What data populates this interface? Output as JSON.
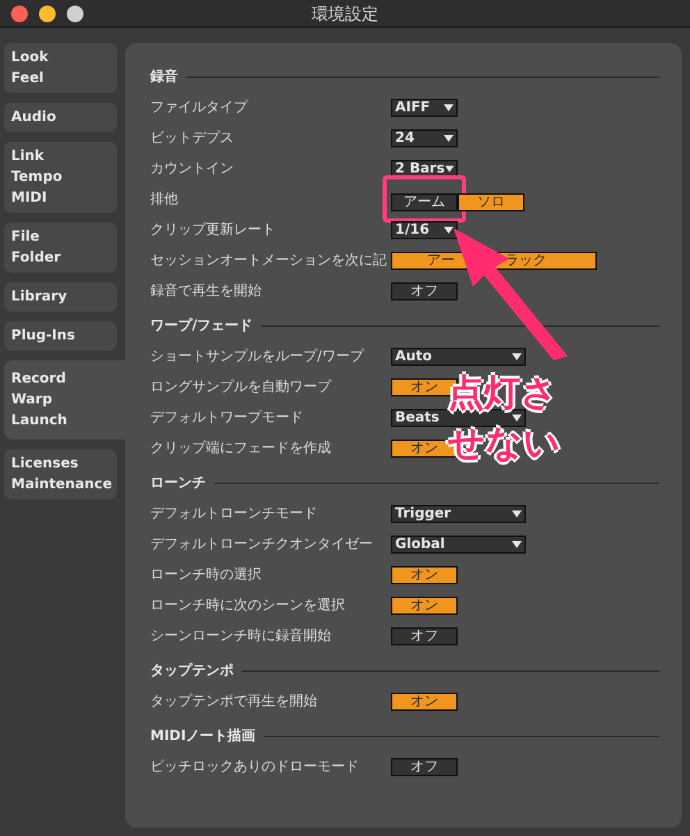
{
  "window": {
    "title": "環境設定"
  },
  "sidebar": [
    {
      "lines": [
        "Look",
        "Feel"
      ],
      "selected": false
    },
    {
      "lines": [
        "Audio"
      ],
      "selected": false
    },
    {
      "lines": [
        "Link",
        "Tempo",
        "MIDI"
      ],
      "selected": false
    },
    {
      "lines": [
        "File",
        "Folder"
      ],
      "selected": false
    },
    {
      "lines": [
        "Library"
      ],
      "selected": false
    },
    {
      "lines": [
        "Plug-Ins"
      ],
      "selected": false
    },
    {
      "lines": [
        "Record",
        "Warp",
        "Launch"
      ],
      "selected": true
    },
    {
      "lines": [
        "Licenses",
        "Maintenance"
      ],
      "selected": false
    }
  ],
  "sections": [
    {
      "title": "録音",
      "rows": [
        {
          "label": "ファイルタイプ",
          "control": {
            "kind": "dropdown",
            "value": "AIFF"
          }
        },
        {
          "label": "ビットデプス",
          "control": {
            "kind": "dropdown",
            "value": "24"
          }
        },
        {
          "label": "カウントイン",
          "control": {
            "kind": "dropdown",
            "value": "2 Bars"
          }
        },
        {
          "label": "排他",
          "control": {
            "kind": "toggle_pair",
            "buttons": [
              {
                "label": "アーム",
                "on": false,
                "highlighted": true
              },
              {
                "label": "ソロ",
                "on": true,
                "highlighted": false
              }
            ]
          }
        },
        {
          "label": "クリップ更新レート",
          "control": {
            "kind": "dropdown",
            "value": "1/16"
          }
        },
        {
          "label": "セッションオートメーションを次に記",
          "control": {
            "kind": "toggle_long",
            "label_parts": [
              "アー",
              "ラック"
            ],
            "on": true
          }
        },
        {
          "label": "録音で再生を開始",
          "control": {
            "kind": "toggle",
            "label": "オフ",
            "on": false
          }
        }
      ]
    },
    {
      "title": "ワープ/フェード",
      "rows": [
        {
          "label": "ショートサンプルをループ/ワープ",
          "control": {
            "kind": "dropdown_long",
            "value": "Auto"
          }
        },
        {
          "label": "ロングサンプルを自動ワープ",
          "control": {
            "kind": "toggle",
            "label": "オン",
            "on": true
          }
        },
        {
          "label": "デフォルトワープモード",
          "control": {
            "kind": "dropdown_long",
            "value": "Beats"
          }
        },
        {
          "label": "クリップ端にフェードを作成",
          "control": {
            "kind": "toggle",
            "label": "オン",
            "on": true
          }
        }
      ]
    },
    {
      "title": "ローンチ",
      "rows": [
        {
          "label": "デフォルトローンチモード",
          "control": {
            "kind": "dropdown_long",
            "value": "Trigger"
          }
        },
        {
          "label": "デフォルトローンチクオンタイゼー",
          "control": {
            "kind": "dropdown_long",
            "value": "Global"
          }
        },
        {
          "label": "ローンチ時の選択",
          "control": {
            "kind": "toggle",
            "label": "オン",
            "on": true
          }
        },
        {
          "label": "ローンチ時に次のシーンを選択",
          "control": {
            "kind": "toggle",
            "label": "オン",
            "on": true
          }
        },
        {
          "label": "シーンローンチ時に録音開始",
          "control": {
            "kind": "toggle",
            "label": "オフ",
            "on": false
          }
        }
      ]
    },
    {
      "title": "タップテンポ",
      "rows": [
        {
          "label": "タップテンポで再生を開始",
          "control": {
            "kind": "toggle",
            "label": "オン",
            "on": true
          }
        }
      ]
    },
    {
      "title": "MIDIノート描画",
      "rows": [
        {
          "label": "ピッチロックありのドローモード",
          "control": {
            "kind": "toggle",
            "label": "オフ",
            "on": false
          }
        }
      ]
    }
  ],
  "annotation": {
    "lines": [
      "点灯さ",
      "せない"
    ]
  }
}
